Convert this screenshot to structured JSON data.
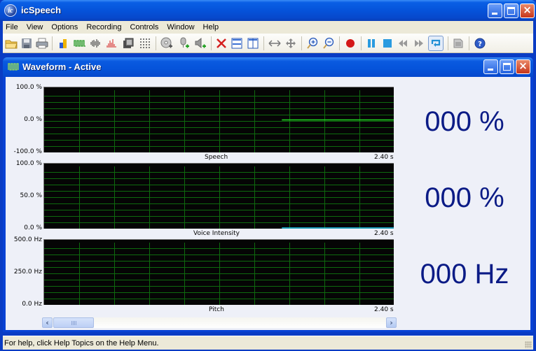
{
  "window": {
    "title": "icSpeech",
    "app_icon": "ic-logo-icon",
    "controls": [
      "minimize",
      "maximize",
      "close"
    ]
  },
  "menu": [
    "File",
    "View",
    "Options",
    "Recording",
    "Controls",
    "Window",
    "Help"
  ],
  "toolbar": {
    "buttons": [
      {
        "name": "open",
        "icon": "folder-icon"
      },
      {
        "name": "save",
        "icon": "floppy-icon"
      },
      {
        "name": "print",
        "icon": "printer-icon"
      },
      {
        "name": "bar-chart",
        "icon": "bar-chart-icon"
      },
      {
        "name": "waveform",
        "icon": "waveform-icon"
      },
      {
        "name": "intensity",
        "icon": "intensity-icon"
      },
      {
        "name": "spectrum",
        "icon": "spectrum-icon"
      },
      {
        "name": "film",
        "icon": "film-icon"
      },
      {
        "name": "grid",
        "icon": "grid-icon"
      },
      {
        "name": "add-source",
        "icon": "disc-add-icon"
      },
      {
        "name": "add-microphone",
        "icon": "microphone-add-icon"
      },
      {
        "name": "add-speaker",
        "icon": "speaker-add-icon"
      },
      {
        "name": "delete",
        "icon": "red-x-icon"
      },
      {
        "name": "tile-horizontal",
        "icon": "tile-horizontal-icon"
      },
      {
        "name": "tile-vertical",
        "icon": "tile-vertical-icon"
      },
      {
        "name": "stretch",
        "icon": "horizontal-arrows-icon"
      },
      {
        "name": "move",
        "icon": "move-icon"
      },
      {
        "name": "zoom-in",
        "icon": "zoom-in-icon"
      },
      {
        "name": "zoom-out",
        "icon": "zoom-out-icon"
      },
      {
        "name": "record",
        "icon": "record-icon"
      },
      {
        "name": "pause",
        "icon": "pause-icon"
      },
      {
        "name": "stop",
        "icon": "stop-icon"
      },
      {
        "name": "rewind",
        "icon": "rewind-icon"
      },
      {
        "name": "fast-forward",
        "icon": "fast-forward-icon"
      },
      {
        "name": "loop",
        "icon": "loop-icon",
        "pressed": true
      },
      {
        "name": "notes",
        "icon": "document-icon"
      },
      {
        "name": "help",
        "icon": "help-icon"
      }
    ]
  },
  "child_window": {
    "title": "Waveform - Active",
    "icon": "waveform-icon"
  },
  "panels": [
    {
      "name": "speech",
      "label": "Speech",
      "time_end": "2.40 s",
      "y_labels": [
        "100.0 %",
        "0.0 %",
        "-100.0 %"
      ],
      "readout": "000 %",
      "line_color": "#22DD22"
    },
    {
      "name": "voice-intensity",
      "label": "Voice Intensity",
      "time_end": "2.40 s",
      "y_labels": [
        "100.0 %",
        "50.0 %",
        "0.0 %"
      ],
      "readout": "000 %",
      "line_color": "#22CCEE"
    },
    {
      "name": "pitch",
      "label": "Pitch",
      "time_end": "2.40 s",
      "y_labels": [
        "500.0 Hz",
        "250.0 Hz",
        "0.0 Hz"
      ],
      "readout": "000 Hz",
      "line_color": "#22DD22"
    }
  ],
  "chart_data": [
    {
      "type": "line",
      "title": "Speech",
      "xlabel": "Speech",
      "x_range": [
        0,
        2.4
      ],
      "x_unit": "s",
      "ylim": [
        -100,
        100
      ],
      "y_unit": "%",
      "ytick_labels": [
        "100.0 %",
        "0.0 %",
        "-100.0 %"
      ],
      "grid": true,
      "grid_color": "#0E6A0E",
      "series": [
        {
          "name": "Speech",
          "color": "#22DD22",
          "x": [
            1.632,
            2.4
          ],
          "y": [
            0,
            0
          ]
        }
      ]
    },
    {
      "type": "line",
      "title": "Voice Intensity",
      "xlabel": "Voice Intensity",
      "x_range": [
        0,
        2.4
      ],
      "x_unit": "s",
      "ylim": [
        0,
        100
      ],
      "y_unit": "%",
      "ytick_labels": [
        "100.0 %",
        "50.0 %",
        "0.0 %"
      ],
      "grid": true,
      "grid_color": "#0E6A0E",
      "series": [
        {
          "name": "Voice Intensity",
          "color": "#22CCEE",
          "x": [
            1.632,
            2.4
          ],
          "y": [
            0,
            0
          ]
        }
      ]
    },
    {
      "type": "line",
      "title": "Pitch",
      "xlabel": "Pitch",
      "x_range": [
        0,
        2.4
      ],
      "x_unit": "s",
      "ylim": [
        0,
        500
      ],
      "y_unit": "Hz",
      "ytick_labels": [
        "500.0 Hz",
        "250.0 Hz",
        "0.0 Hz"
      ],
      "grid": true,
      "grid_color": "#0E6A0E",
      "series": [
        {
          "name": "Pitch",
          "color": "#22DD22",
          "x": [],
          "y": []
        }
      ]
    }
  ],
  "scrollbar": {
    "left_arrow": "‹",
    "right_arrow": "›"
  },
  "status": {
    "text": "For help, click Help Topics on the Help Menu."
  }
}
